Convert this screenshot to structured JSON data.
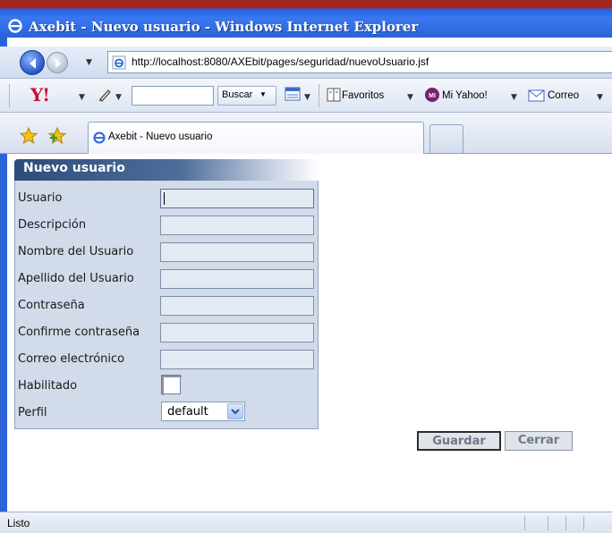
{
  "window": {
    "title": "Axebit - Nuevo usuario - Windows Internet Explorer"
  },
  "address": {
    "url": "http://localhost:8080/AXEbit/pages/seguridad/nuevoUsuario.jsf"
  },
  "toolbar": {
    "logo": "Y!",
    "search_button": "Buscar",
    "favoritos": "Favoritos",
    "mi_yahoo": "Mi Yahoo!",
    "correo": "Correo"
  },
  "tab": {
    "label": "Axebit - Nuevo usuario"
  },
  "form": {
    "title": "Nuevo usuario",
    "fields": [
      {
        "label": "Usuario",
        "value": ""
      },
      {
        "label": "Descripción",
        "value": ""
      },
      {
        "label": "Nombre del Usuario",
        "value": ""
      },
      {
        "label": "Apellido del Usuario",
        "value": ""
      },
      {
        "label": "Contraseña",
        "value": ""
      },
      {
        "label": "Confirme contraseña",
        "value": ""
      },
      {
        "label": "Correo electrónico",
        "value": ""
      }
    ],
    "habilitado_label": "Habilitado",
    "habilitado_checked": false,
    "perfil_label": "Perfil",
    "perfil_value": "default"
  },
  "buttons": {
    "guardar": "Guardar",
    "cerrar": "Cerrar"
  },
  "status": {
    "text": "Listo"
  },
  "colors": {
    "form_panel": "#d1dbe9",
    "header_dark": "#2c4c7a",
    "ie_blue": "#2a63d8"
  }
}
